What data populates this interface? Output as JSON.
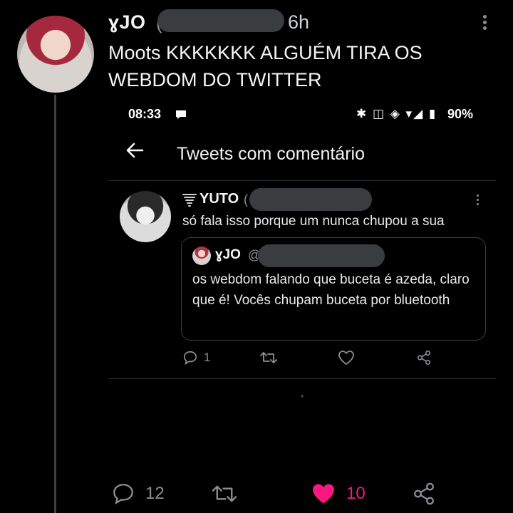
{
  "tweet": {
    "author_name": "ɣJO",
    "handle_start": "(",
    "time": "6h",
    "text": "Moots KKKKKKK ALGUÉM TIRA OS WEBDOM DO TWITTER"
  },
  "screenshot": {
    "status_bar": {
      "time": "08:33",
      "icons": "✱ ◫ ◈ ▾◢ ▮",
      "battery": "90%"
    },
    "page_title": "Tweets com comentário",
    "reply": {
      "author_name": "YUTO",
      "handle_start": "(",
      "text": "só fala isso porque um nunca chupou a sua",
      "quoted": {
        "author_name": "ɣJO",
        "handle_start": "@",
        "text": "os webdom falando que buceta é azeda, claro que é! Vocês chupam buceta por bluetooth"
      },
      "reply_count": "1"
    }
  },
  "actions": {
    "reply_count": "12",
    "like_count": "10"
  },
  "colors": {
    "background": "#000000",
    "like_pink": "#f91880",
    "muted": "#8b8f93"
  }
}
